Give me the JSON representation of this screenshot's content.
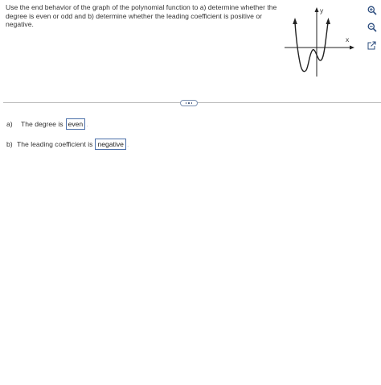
{
  "question": {
    "text": "Use the end behavior of the graph of the polynomial function to a) determine whether the degree is even or odd and b) determine whether the leading coefficient is positive or negative."
  },
  "graph": {
    "x_axis_label": "x",
    "y_axis_label": "y"
  },
  "toolbar": {
    "zoom_in_icon": "zoom-in-icon",
    "zoom_out_icon": "zoom-out-icon",
    "popout_icon": "external-link-icon"
  },
  "colors": {
    "accent": "#4a6ea8",
    "divider": "#b8b8b8",
    "text": "#333333"
  },
  "answers": {
    "a": {
      "label": "a)",
      "prompt": "The degree is",
      "value": "even",
      "suffix": "."
    },
    "b": {
      "label": "b)",
      "prompt": "The leading coefficient is",
      "value": "negative",
      "suffix": "."
    }
  }
}
